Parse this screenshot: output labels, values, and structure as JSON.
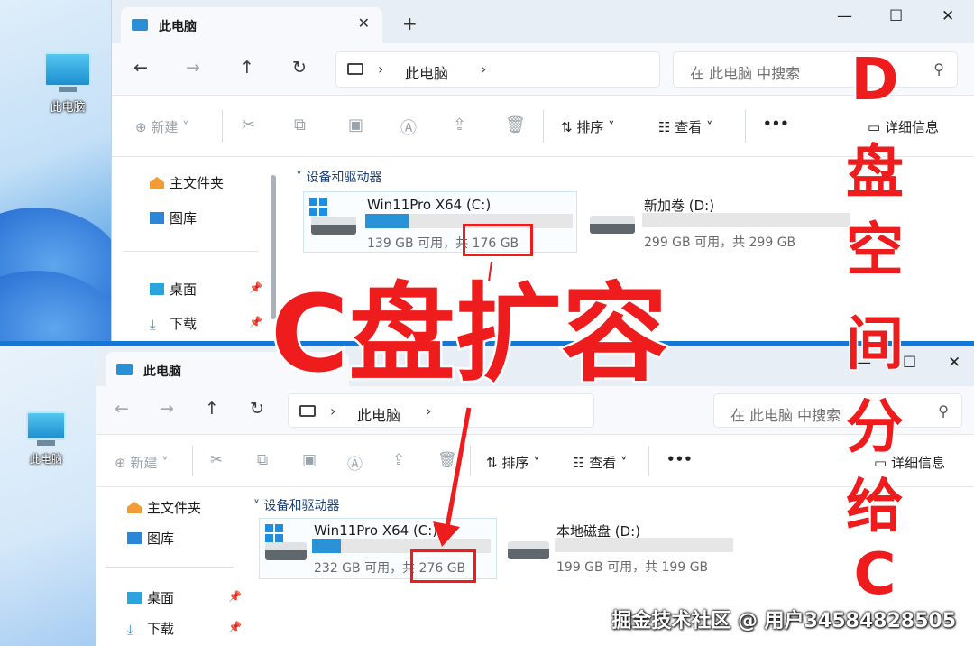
{
  "top": {
    "desktop_icon_label": "此电脑",
    "tab_title": "此电脑",
    "tab_close": "✕",
    "new_tab": "+",
    "window_controls": {
      "minimize": "—",
      "maximize": "☐",
      "close": "✕"
    },
    "nav": {
      "back": "←",
      "forward": "→",
      "up": "↑",
      "refresh": "↻"
    },
    "path": {
      "chevron": "›",
      "location": "此电脑"
    },
    "search_placeholder": "在 此电脑 中搜索",
    "toolbar": {
      "new": "新建",
      "sort": "排序",
      "view": "查看",
      "more": "•••",
      "details": "详细信息"
    },
    "nav_items": {
      "home": "主文件夹",
      "gallery": "图库",
      "desktop": "桌面",
      "downloads": "下载"
    },
    "section_label": "设备和驱动器",
    "drives": [
      {
        "name": "Win11Pro X64 (C:)",
        "free_label": "139 GB 可用，共",
        "total": "176 GB",
        "used_fraction": 0.21
      },
      {
        "name": "新加卷 (D:)",
        "free_label": "299 GB 可用，共 299 GB",
        "used_fraction": 0.0
      }
    ]
  },
  "bottom": {
    "desktop_icon_label": "此电脑",
    "tab_title": "此电脑",
    "window_controls": {
      "minimize": "—",
      "maximize": "☐",
      "close": "✕"
    },
    "nav": {
      "back": "←",
      "forward": "→",
      "up": "↑",
      "refresh": "↻"
    },
    "path": {
      "chevron": "›",
      "location": "此电脑"
    },
    "search_placeholder": "在 此电脑 中搜索",
    "toolbar": {
      "new": "新建",
      "sort": "排序",
      "view": "查看",
      "more": "•••",
      "details": "详细信息"
    },
    "nav_items": {
      "home": "主文件夹",
      "gallery": "图库",
      "desktop": "桌面",
      "downloads": "下载"
    },
    "section_label": "设备和驱动器",
    "drives": [
      {
        "name": "Win11Pro X64 (C:)",
        "free_label": "232 GB 可用，共",
        "total": "276 GB",
        "used_fraction": 0.16
      },
      {
        "name": "本地磁盘 (D:)",
        "free_label": "199 GB 可用，共 199 GB",
        "used_fraction": 0.0
      }
    ]
  },
  "overlay": {
    "headline": "C盘扩容",
    "side_chars": [
      "D",
      "盘",
      "空",
      "间",
      "分",
      "给",
      "C"
    ],
    "watermark": "掘金技术社区 @ 用户3458482850​5"
  },
  "colors": {
    "accent_red": "#ee1c1c",
    "drive_bar": "#2a93d8",
    "divider": "#1677d2"
  },
  "icons": [
    "monitor-icon",
    "home-icon",
    "gallery-icon",
    "desktop-folder-icon",
    "download-icon",
    "pin-icon",
    "windows-logo-icon",
    "disk-icon",
    "search-icon",
    "cut-icon",
    "copy-icon",
    "paste-icon",
    "rename-icon",
    "share-icon",
    "delete-icon",
    "sort-icon",
    "view-icon",
    "details-icon"
  ]
}
